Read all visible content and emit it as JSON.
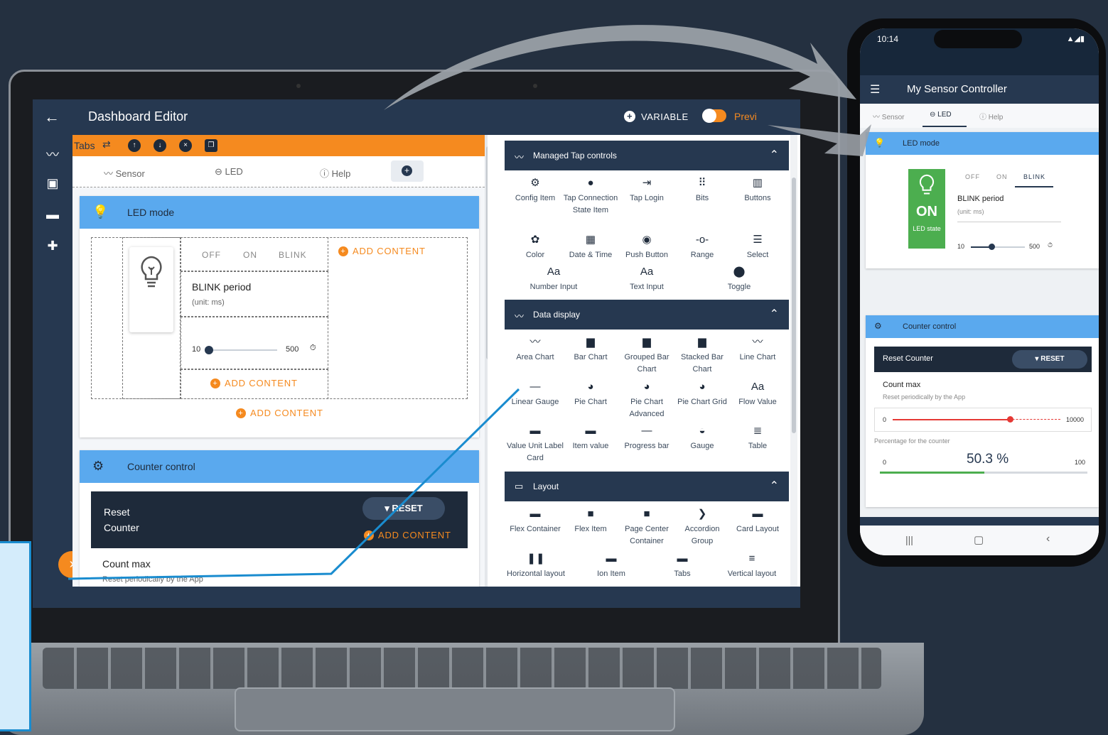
{
  "editor": {
    "title": "Dashboard Editor",
    "variable_label": "VARIABLE",
    "preview_label": "Previ",
    "tabs_label": "Tabs",
    "tabs": [
      {
        "label": "Sensor",
        "icon": "line-chart-icon"
      },
      {
        "label": "LED",
        "icon": "toggle-icon"
      },
      {
        "label": "Help",
        "icon": "help-circle-icon"
      }
    ],
    "led_card": {
      "title": "LED mode",
      "segments": [
        "OFF",
        "ON",
        "BLINK"
      ],
      "blink_label": "BLINK period",
      "unit_label": "(unit: ms)",
      "slider_min": "10",
      "slider_max": "500",
      "slider_value_fraction": 0.04,
      "add_content": "ADD CONTENT"
    },
    "counter_card": {
      "title": "Counter control",
      "reset_title": "Reset Counter",
      "reset_button": "RESET",
      "count_max": "Count max",
      "count_sub": "Reset periodically by the App"
    },
    "user_initial": "S"
  },
  "palette": {
    "sections": [
      {
        "title": "Managed Tap controls",
        "items": [
          {
            "label": "Config Item",
            "icon": "gear-icon"
          },
          {
            "label": "Tap Connection State Item",
            "icon": "alert-circle-icon"
          },
          {
            "label": "Tap Login",
            "icon": "login-icon"
          },
          {
            "label": "Bits",
            "icon": "dots-grid-icon"
          },
          {
            "label": "Buttons",
            "icon": "columns-icon"
          },
          {
            "label": "Color",
            "icon": "palette-icon"
          },
          {
            "label": "Date & Time",
            "icon": "calendar-icon"
          },
          {
            "label": "Push Button",
            "icon": "radio-button-icon"
          },
          {
            "label": "Range",
            "icon": "range-icon"
          },
          {
            "label": "Select",
            "icon": "list-icon"
          },
          {
            "label": "Number Input",
            "icon": "text-aa-icon"
          },
          {
            "label": "Text Input",
            "icon": "text-aa-icon"
          },
          {
            "label": "Toggle",
            "icon": "toggle-icon"
          }
        ]
      },
      {
        "title": "Data display",
        "items": [
          {
            "label": "Area Chart",
            "icon": "line-chart-icon"
          },
          {
            "label": "Bar Chart",
            "icon": "bar-chart-icon"
          },
          {
            "label": "Grouped Bar Chart",
            "icon": "bar-chart-icon"
          },
          {
            "label": "Stacked Bar Chart",
            "icon": "bar-chart-icon"
          },
          {
            "label": "Line Chart",
            "icon": "line-chart-icon"
          },
          {
            "label": "Linear Gauge",
            "icon": "minus-icon"
          },
          {
            "label": "Pie Chart",
            "icon": "pie-icon"
          },
          {
            "label": "Pie Chart Advanced",
            "icon": "pie-icon"
          },
          {
            "label": "Pie Chart Grid",
            "icon": "pie-icon"
          },
          {
            "label": "Flow Value",
            "icon": "text-aa-icon"
          },
          {
            "label": "Value Unit Label Card",
            "icon": "card-icon"
          },
          {
            "label": "Item value",
            "icon": "monitor-icon"
          },
          {
            "label": "Progress bar",
            "icon": "minus-icon"
          },
          {
            "label": "Gauge",
            "icon": "gauge-icon"
          },
          {
            "label": "Table",
            "icon": "table-icon"
          }
        ]
      },
      {
        "title": "Layout",
        "items": [
          {
            "label": "Flex Container",
            "icon": "flex-icon"
          },
          {
            "label": "Flex Item",
            "icon": "square-icon"
          },
          {
            "label": "Page Center Container",
            "icon": "square-icon"
          },
          {
            "label": "Accordion Group",
            "icon": "chevron-circle-icon"
          },
          {
            "label": "Card Layout",
            "icon": "card-icon"
          },
          {
            "label": "Horizontal layout",
            "icon": "pause-icon"
          },
          {
            "label": "Ion Item",
            "icon": "monitor-icon"
          },
          {
            "label": "Tabs",
            "icon": "tabs-icon"
          },
          {
            "label": "Vertical layout",
            "icon": "menu-icon"
          }
        ]
      }
    ]
  },
  "phone": {
    "time": "10:14",
    "app_title": "My Sensor Controller",
    "tabs": [
      "Sensor",
      "LED",
      "Help"
    ],
    "led_title": "LED mode",
    "segments": [
      "OFF",
      "ON",
      "BLINK"
    ],
    "led_state_value": "ON",
    "led_state_label": "LED state",
    "blink_label": "BLINK period",
    "unit_label": "(unit: ms)",
    "slider_min": "10",
    "slider_max": "500",
    "counter_title": "Counter control",
    "reset_title": "Reset Counter",
    "reset_button": "RESET",
    "count_max": "Count max",
    "count_sub": "Reset periodically by the App",
    "count_min": "0",
    "count_max_value": "10000",
    "count_fraction": 0.5,
    "percentage_label": "Percentage for the counter",
    "pct_min": "0",
    "pct_value": "50.3 %",
    "pct_max": "100",
    "pct_fraction": 0.503
  },
  "colors": {
    "navy": "#263850",
    "accent_orange": "#f58a1f",
    "card_header_blue": "#5aa9ee",
    "led_green": "#4cae4f",
    "slider_red": "#e53935",
    "callout_blue": "#1a8ccf"
  }
}
